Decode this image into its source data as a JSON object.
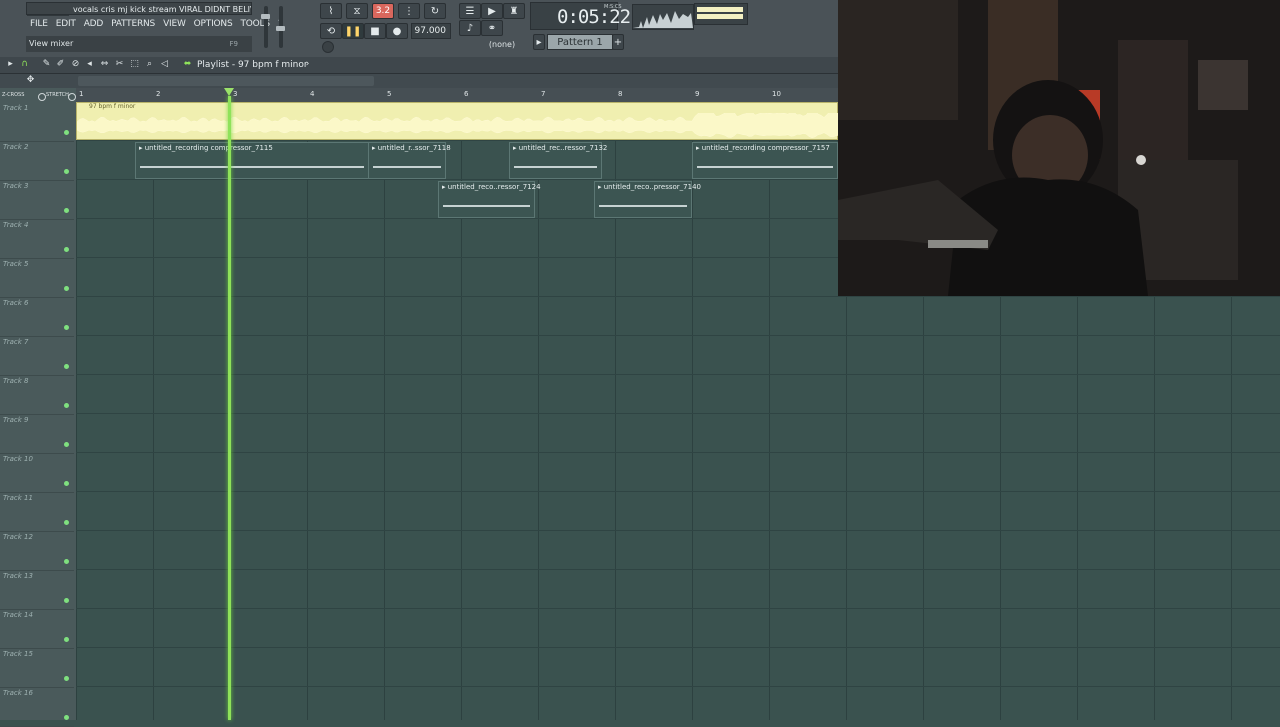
{
  "window": {
    "title": "vocals cris mj kick stream VIRAL DIDNT BELIVE I..."
  },
  "menu": [
    "FILE",
    "EDIT",
    "ADD",
    "PATTERNS",
    "VIEW",
    "OPTIONS",
    "TOOLS",
    "?"
  ],
  "hint": {
    "text": "View mixer",
    "shortcut": "F9"
  },
  "transport": {
    "tempo": "97.000",
    "time": "0:05:22",
    "time_unit": "M:S:CS",
    "pattern": "Pattern 1",
    "channel_target": "(none)",
    "record_mode": "3.2"
  },
  "playlist": {
    "title": "Playlist - 97 bpm f minor",
    "bars": [
      "1",
      "2",
      "3",
      "4",
      "5",
      "6",
      "7",
      "8",
      "9",
      "10"
    ],
    "master_clip": "97 bpm f minor",
    "mode_labels": [
      "Z-CROSS",
      "STRETCH"
    ],
    "clips": [
      {
        "name": "untitled_recording compressor_7115",
        "track": 2
      },
      {
        "name": "untitled_r..ssor_7118",
        "track": 2
      },
      {
        "name": "untitled_rec..ressor_7132",
        "track": 2
      },
      {
        "name": "untitled_recording compressor_7157",
        "track": 2
      },
      {
        "name": "untitled_reco..ressor_7124",
        "track": 3
      },
      {
        "name": "untitled_reco..pressor_7140",
        "track": 3
      }
    ],
    "tracks": [
      "Track 1",
      "Track 2",
      "Track 3",
      "Track 4",
      "Track 5",
      "Track 6",
      "Track 7",
      "Track 8",
      "Track 9",
      "Track 10",
      "Track 11",
      "Track 12",
      "Track 13",
      "Track 14",
      "Track 15",
      "Track 16"
    ]
  },
  "colors": {
    "grid_bg": "#3a524f",
    "master_clip": "#f0efb0",
    "playhead": "#8fe25a",
    "clip_bg": "#3c5552"
  }
}
